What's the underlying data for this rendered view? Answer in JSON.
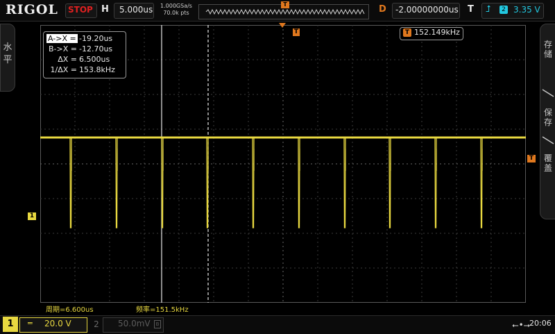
{
  "brand": "RIGOL",
  "run_state": "STOP",
  "timebase": {
    "label": "H",
    "value": "5.000us"
  },
  "sample": {
    "rate": "1.000GSa/s",
    "points": "70.0k pts"
  },
  "delay": {
    "label": "D",
    "value": "-2.00000000us"
  },
  "trigger": {
    "label": "T",
    "source": "2",
    "level": "3.35 V"
  },
  "left_tab": {
    "chars": [
      "水",
      "平"
    ]
  },
  "right_tab": {
    "items": [
      "存储",
      "保存",
      "覆盖"
    ]
  },
  "cursor": {
    "rows": [
      {
        "label": "A->X =",
        "value": "-19.20us"
      },
      {
        "label": "B->X =",
        "value": "-12.70us"
      },
      {
        "label": "ΔX =",
        "value": "6.500us"
      },
      {
        "label": "1/ΔX =",
        "value": "153.8kHz"
      }
    ]
  },
  "freq_counter": {
    "badge": "T",
    "value": "152.149kHz"
  },
  "markers": {
    "trigger_top": "T",
    "trigger_level": "T",
    "ch1_ground": "1"
  },
  "measurements": [
    {
      "label": "周期=",
      "value": "6.600us"
    },
    {
      "label": "频率=",
      "value": "151.5kHz"
    }
  ],
  "channels": [
    {
      "id": "1",
      "coupling": "═",
      "scale": "20.0 V",
      "active": true
    },
    {
      "id": "2",
      "scale": "50.0mV",
      "bw": "B",
      "active": false
    }
  ],
  "clock": "20:06",
  "colors": {
    "ch1": "#e8d840",
    "trigger": "#e0781e",
    "ch2": "#22c8e0",
    "stop": "#e02020"
  },
  "icons": [
    "usb-icon",
    "rising-edge-icon"
  ]
}
